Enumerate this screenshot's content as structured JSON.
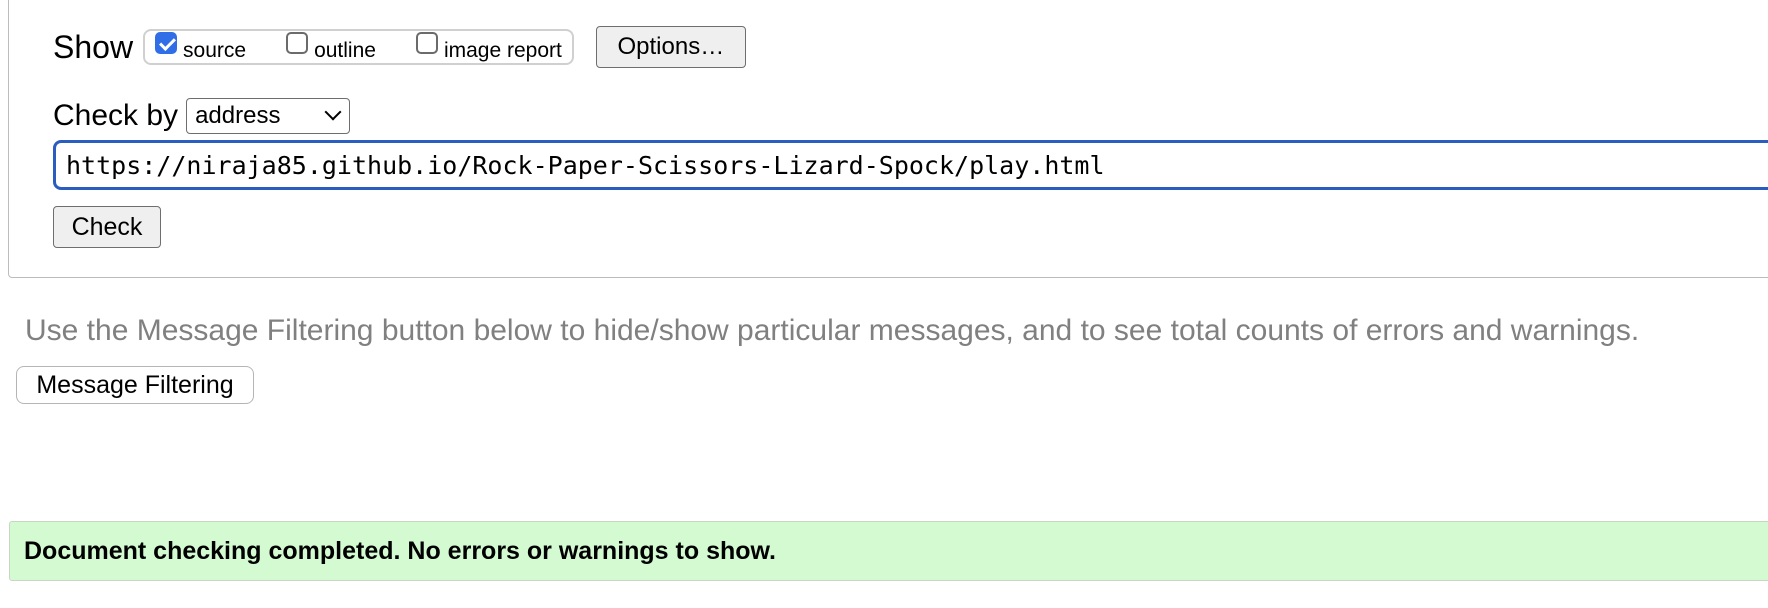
{
  "show": {
    "label": "Show",
    "options": [
      {
        "label": "source",
        "checked": true
      },
      {
        "label": "outline",
        "checked": false
      },
      {
        "label": "image report",
        "checked": false
      }
    ],
    "options_button": "Options…"
  },
  "check_by": {
    "label": "Check by",
    "selected": "address"
  },
  "url_input": {
    "value": "https://niraja85.github.io/Rock-Paper-Scissors-Lizard-Spock/play.html"
  },
  "check_button": "Check",
  "hint": "Use the Message Filtering button below to hide/show particular messages, and to see total counts of errors and warnings.",
  "filter_button": "Message Filtering",
  "result": {
    "message": "Document checking completed. No errors or warnings to show.",
    "color": "#d4fad1"
  },
  "colors": {
    "accent": "#2f6ee6",
    "input_focus_border": "#2a5dbf",
    "hint_text": "#808080"
  },
  "icons": {
    "select_arrow": "chevron-down-icon",
    "checkbox_checked": "checkmark-icon"
  }
}
